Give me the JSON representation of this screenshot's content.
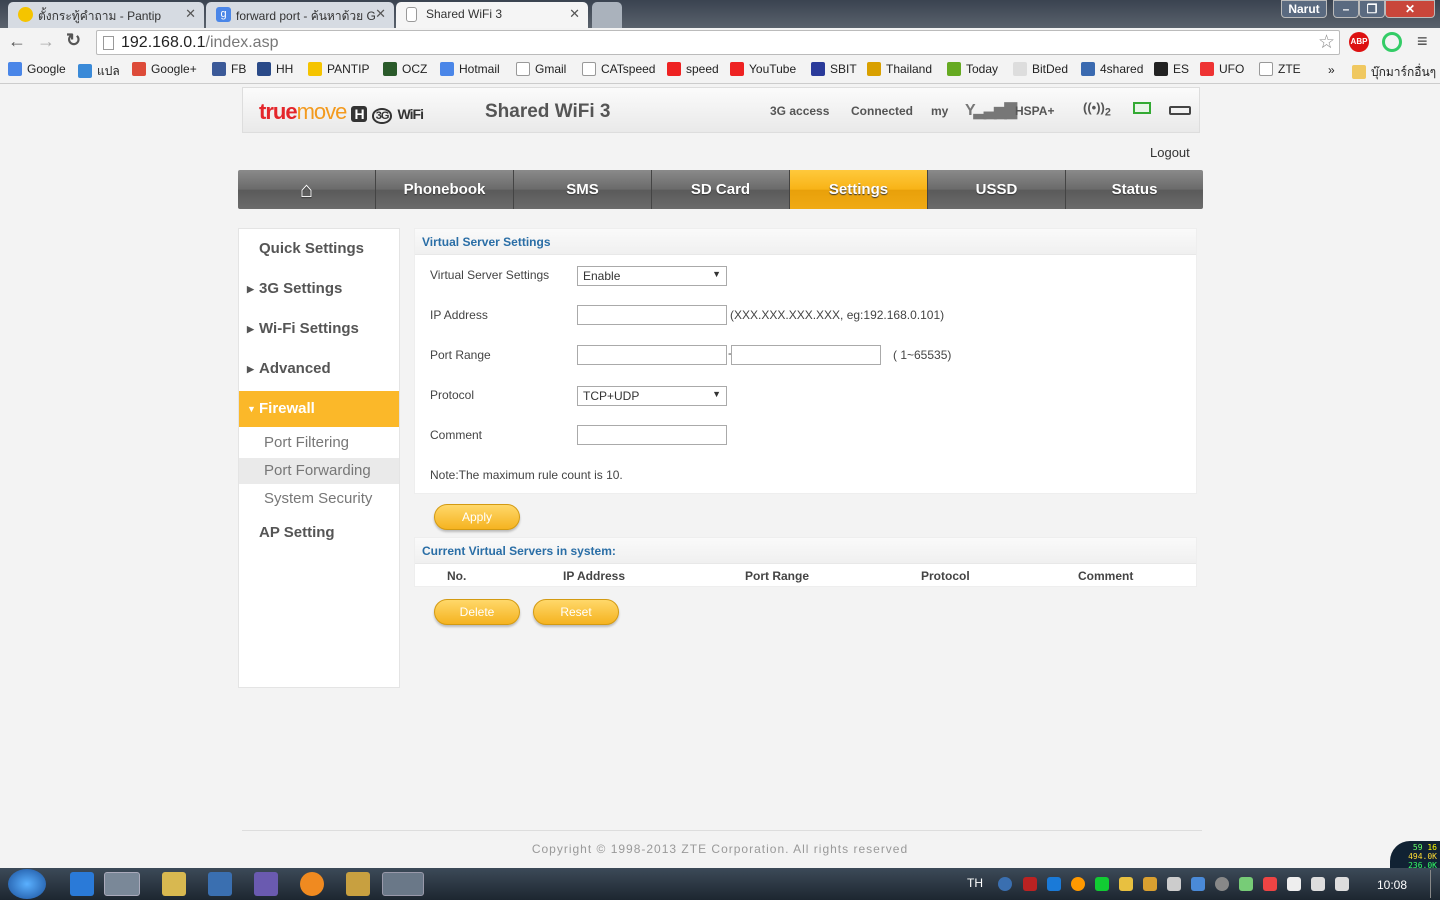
{
  "browser": {
    "tabs": [
      {
        "title": "ตั้งกระทู้คำถาม - Pantip",
        "icon": "pantip-smiley-icon"
      },
      {
        "title": "forward port - ค้นหาด้วย G",
        "icon": "google-icon"
      },
      {
        "title": "Shared WiFi 3",
        "icon": "page-icon",
        "active": true
      }
    ],
    "user": "Narut",
    "url_host": "192.168.0.1",
    "url_path": "/index.asp",
    "bookmarks": [
      "Google",
      "แปล",
      "Google+",
      "FB",
      "HH",
      "PANTIP",
      "OCZ",
      "Hotmail",
      "Gmail",
      "CATspeed",
      "speed",
      "YouTube",
      "SBIT",
      "Thailand",
      "Today",
      "BitDed",
      "4shared",
      "ES",
      "UFO",
      "ZTE"
    ],
    "more": "»",
    "other_bookmarks": "บุ๊กมาร์กอื่นๆ",
    "ext_abp": "ABP"
  },
  "header": {
    "logo_true": "true",
    "logo_move": "move",
    "logo_h": "H",
    "logo_3g": "3G",
    "logo_wifi": "WiFi",
    "title": "Shared WiFi 3",
    "access": "3G access",
    "connection": "Connected",
    "operator": "my",
    "network": "HSPA+",
    "wifi_clients": "2"
  },
  "logout": "Logout",
  "nav": [
    "Phonebook",
    "SMS",
    "SD Card",
    "Settings",
    "USSD",
    "Status"
  ],
  "nav_active": "Settings",
  "sidebar": {
    "items": [
      "Quick Settings",
      "3G Settings",
      "Wi-Fi Settings",
      "Advanced",
      "Firewall",
      "AP Setting"
    ],
    "firewall_sub": [
      "Port Filtering",
      "Port Forwarding",
      "System Security"
    ],
    "current": "Port Forwarding"
  },
  "form": {
    "section_title": "Virtual Server Settings",
    "vs_label": "Virtual Server Settings",
    "vs_value": "Enable",
    "ip_label": "IP Address",
    "ip_value": "",
    "ip_hint": "(XXX.XXX.XXX.XXX, eg:192.168.0.101)",
    "port_label": "Port Range",
    "port_from": "",
    "port_to": "",
    "port_hint": "( 1~65535)",
    "protocol_label": "Protocol",
    "protocol_value": "TCP+UDP",
    "comment_label": "Comment",
    "comment_value": "",
    "note": "Note:The maximum rule count is 10.",
    "apply": "Apply"
  },
  "list": {
    "title": "Current Virtual Servers in system:",
    "columns": [
      "No.",
      "IP Address",
      "Port Range",
      "Protocol",
      "Comment"
    ],
    "rows": [],
    "delete": "Delete",
    "reset": "Reset"
  },
  "footer": "Copyright © 1998-2013 ZTE Corporation. All rights reserved",
  "taskbar": {
    "lang": "TH",
    "time": "10:08",
    "net_up": "494.0K",
    "net_down": "236.0K",
    "cpu": "59",
    "mem": "16"
  },
  "colors": {
    "accent": "#fbb829",
    "link": "#2a6ea6",
    "brand_red": "#e4262b"
  }
}
